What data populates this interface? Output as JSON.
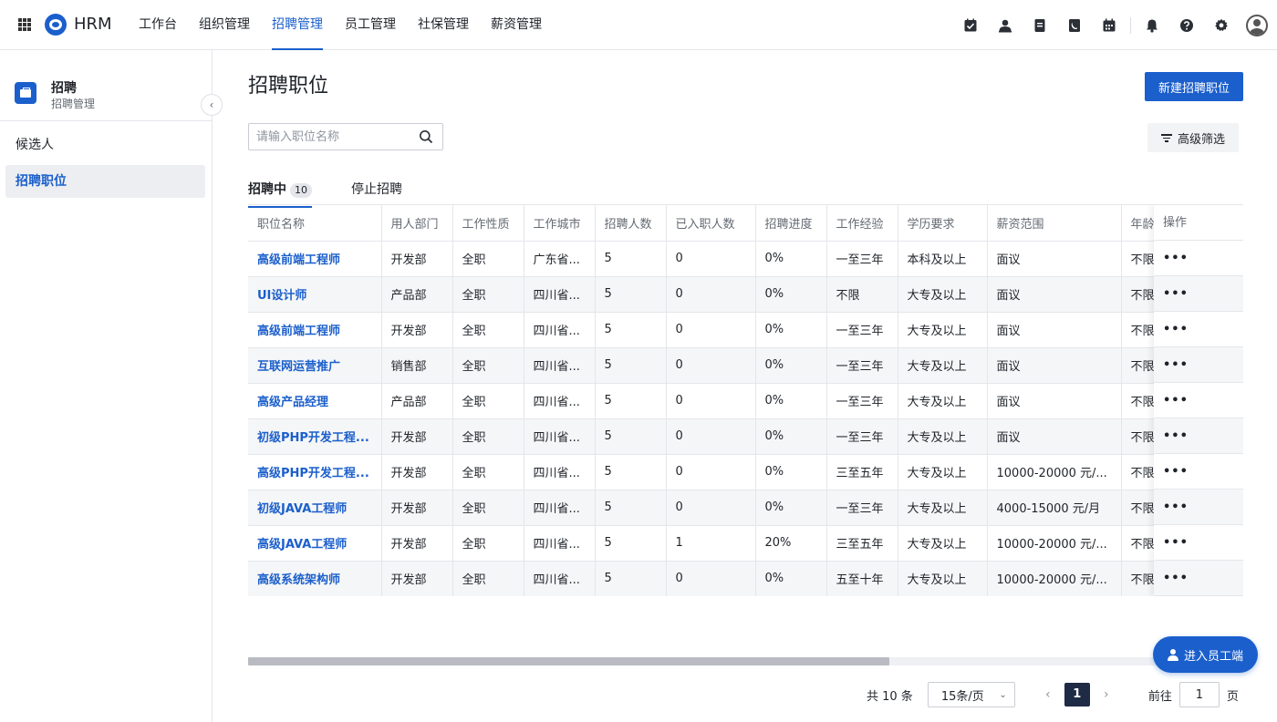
{
  "app": {
    "brand": "HRM"
  },
  "nav": [
    {
      "label": "工作台",
      "active": false
    },
    {
      "label": "组织管理",
      "active": false
    },
    {
      "label": "招聘管理",
      "active": true
    },
    {
      "label": "员工管理",
      "active": false
    },
    {
      "label": "社保管理",
      "active": false
    },
    {
      "label": "薪资管理",
      "active": false
    }
  ],
  "top_icons": [
    "checkbox-icon",
    "user-icon",
    "document-icon",
    "contacts-icon",
    "calendar-icon",
    "bell-icon",
    "help-icon",
    "gear-icon",
    "avatar"
  ],
  "sidebar": {
    "module_title": "招聘",
    "module_sub": "招聘管理",
    "items": [
      {
        "label": "候选人",
        "active": false
      },
      {
        "label": "招聘职位",
        "active": true
      }
    ]
  },
  "main": {
    "title": "招聘职位",
    "create_button": "新建招聘职位",
    "search_placeholder": "请输入职位名称",
    "filter_button": "高级筛选",
    "tabs": [
      {
        "label": "招聘中",
        "badge": "10"
      },
      {
        "label": "停止招聘",
        "badge": ""
      }
    ]
  },
  "table": {
    "columns": [
      "职位名称",
      "用人部门",
      "工作性质",
      "工作城市",
      "招聘人数",
      "已入职人数",
      "招聘进度",
      "工作经验",
      "学历要求",
      "薪资范围",
      "年龄"
    ],
    "ops_header": "操作",
    "ops_label": "•••",
    "rows": [
      [
        "高级前端工程师",
        "开发部",
        "全职",
        "广东省...",
        "5",
        "0",
        "0%",
        "一至三年",
        "本科及以上",
        "面议",
        "不限"
      ],
      [
        "UI设计师",
        "产品部",
        "全职",
        "四川省...",
        "5",
        "0",
        "0%",
        "不限",
        "大专及以上",
        "面议",
        "不限"
      ],
      [
        "高级前端工程师",
        "开发部",
        "全职",
        "四川省...",
        "5",
        "0",
        "0%",
        "一至三年",
        "大专及以上",
        "面议",
        "不限"
      ],
      [
        "互联网运营推广",
        "销售部",
        "全职",
        "四川省...",
        "5",
        "0",
        "0%",
        "一至三年",
        "大专及以上",
        "面议",
        "不限"
      ],
      [
        "高级产品经理",
        "产品部",
        "全职",
        "四川省...",
        "5",
        "0",
        "0%",
        "一至三年",
        "大专及以上",
        "面议",
        "不限"
      ],
      [
        "初级PHP开发工程...",
        "开发部",
        "全职",
        "四川省...",
        "5",
        "0",
        "0%",
        "一至三年",
        "大专及以上",
        "面议",
        "不限"
      ],
      [
        "高级PHP开发工程...",
        "开发部",
        "全职",
        "四川省...",
        "5",
        "0",
        "0%",
        "三至五年",
        "大专及以上",
        "10000-20000 元/...",
        "不限"
      ],
      [
        "初级JAVA工程师",
        "开发部",
        "全职",
        "四川省...",
        "5",
        "0",
        "0%",
        "一至三年",
        "大专及以上",
        "4000-15000 元/月",
        "不限"
      ],
      [
        "高级JAVA工程师",
        "开发部",
        "全职",
        "四川省...",
        "5",
        "1",
        "20%",
        "三至五年",
        "大专及以上",
        "10000-20000 元/...",
        "不限"
      ],
      [
        "高级系统架构师",
        "开发部",
        "全职",
        "四川省...",
        "5",
        "0",
        "0%",
        "五至十年",
        "大专及以上",
        "10000-20000 元/...",
        "不限"
      ]
    ]
  },
  "float_button": "进入员工端",
  "pagination": {
    "total": "共 10 条",
    "page_size": "15条/页",
    "current_page": "1",
    "jump_label": "前往",
    "jump_value": "1",
    "jump_suffix": "页"
  },
  "colors": {
    "primary": "#1b5fcc",
    "link": "#1b5fcc",
    "row_alt": "#f5f6f7"
  }
}
